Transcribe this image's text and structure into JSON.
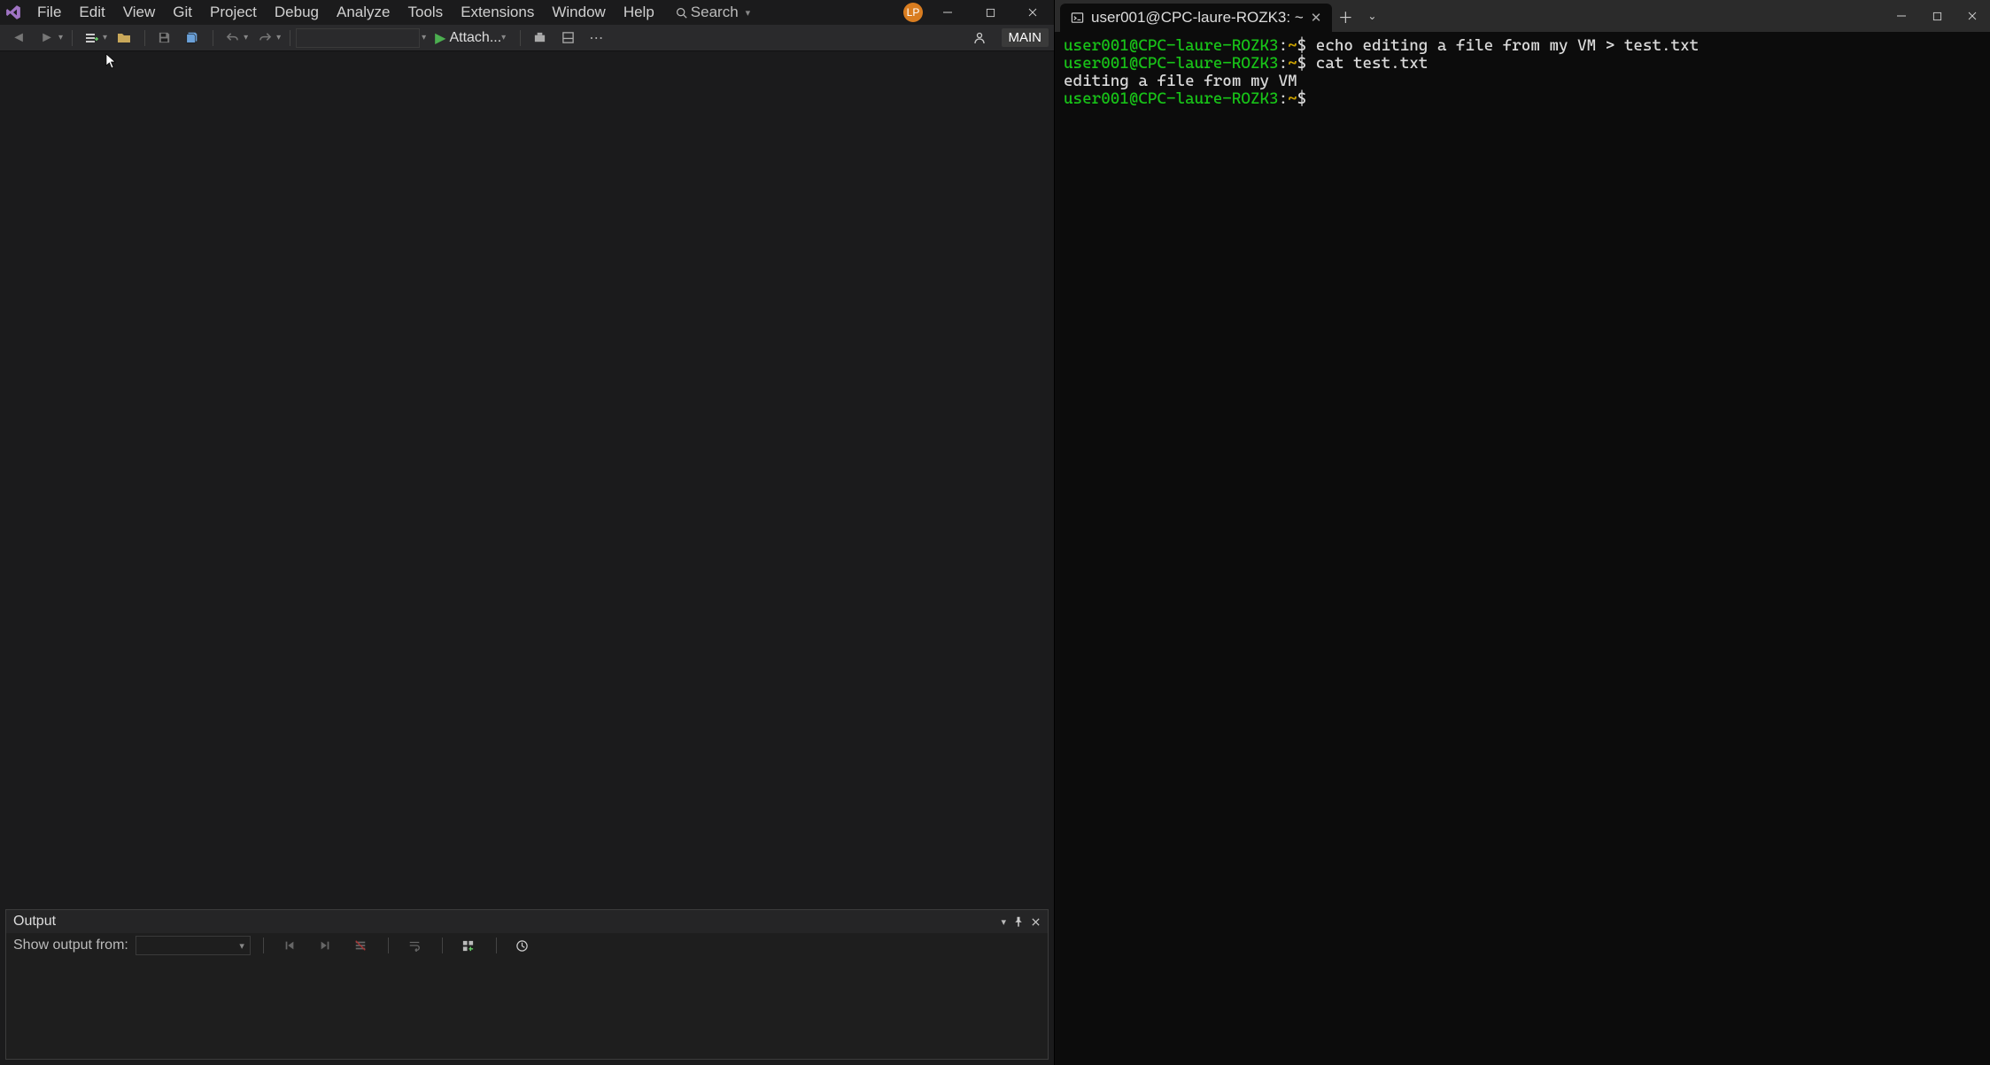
{
  "vs": {
    "menu": [
      "File",
      "Edit",
      "View",
      "Git",
      "Project",
      "Debug",
      "Analyze",
      "Tools",
      "Extensions",
      "Window",
      "Help"
    ],
    "search_label": "Search",
    "user_initials": "LP",
    "toolbar": {
      "attach_label": "Attach...",
      "main_badge": "MAIN"
    },
    "output": {
      "title": "Output",
      "show_from_label": "Show output from:"
    }
  },
  "terminal": {
    "tab_title": "user001@CPC-laure-ROZK3: ~",
    "prompt_user": "user001@CPC-laure-ROZK3",
    "prompt_path": "~",
    "prompt_symbol": "$",
    "lines": [
      {
        "cmd": "echo editing a file from my VM > test.txt"
      },
      {
        "cmd": "cat test.txt"
      },
      {
        "out": "editing a file from my VM"
      },
      {
        "cmd": ""
      }
    ]
  }
}
